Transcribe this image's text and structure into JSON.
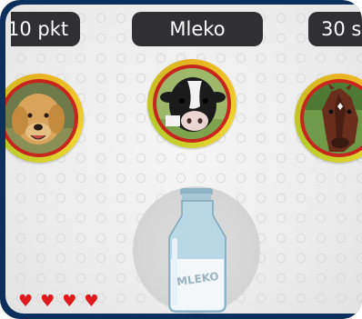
{
  "hud": {
    "score": "10 pkt",
    "word": "Mleko",
    "timer": "30 s"
  },
  "choices": [
    {
      "animal": "dog",
      "icon": "dog-photo"
    },
    {
      "animal": "cow",
      "icon": "cow-photo"
    },
    {
      "animal": "horse",
      "icon": "horse-photo"
    }
  ],
  "target": {
    "label": "MLEKO",
    "icon": "milk-bottle"
  },
  "lives": {
    "count": 4,
    "icon": "heart-icon",
    "color": "#e0191d"
  },
  "colors": {
    "frame": "#0c2f5c",
    "hud_bg": "#303033",
    "ring_outer": "#e8b320",
    "ring_inner": "#c6261d"
  }
}
